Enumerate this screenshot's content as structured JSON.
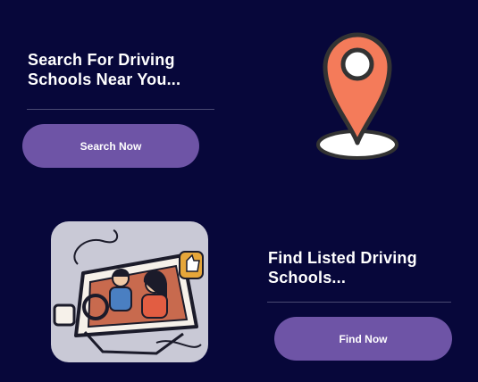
{
  "search_card": {
    "heading_line1": "Search For Driving",
    "heading_line2": "Schools Near You...",
    "button_label": "Search Now"
  },
  "find_card": {
    "heading_line1": "Find Listed Driving",
    "heading_line2": "Schools...",
    "button_label": "Find Now"
  },
  "colors": {
    "background": "#07073a",
    "button": "#6e54a6",
    "pin": "#f47b5a",
    "divider": "#4a4a72"
  },
  "icons": {
    "location": "location-pin-icon",
    "driving": "driving-lesson-illustration"
  }
}
